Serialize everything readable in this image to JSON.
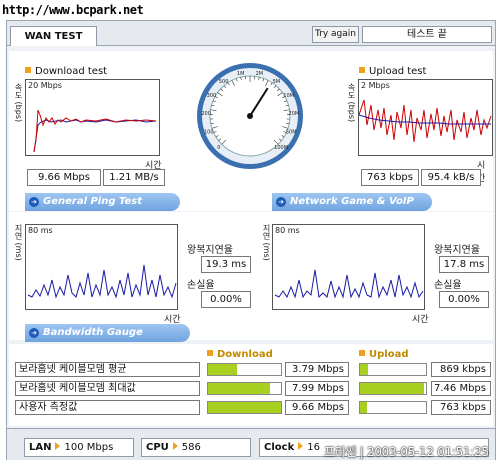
{
  "watermark_top": "http://www.bcpark.net",
  "tab": "WAN TEST",
  "try_again": "Try again",
  "status": "테스트 끝",
  "download": {
    "title": "Download test",
    "ylabel": "속도 (bps)",
    "scale": "20 Mbps",
    "time": "시간",
    "value1": "9.66 Mbps",
    "value2": "1.21 MB/s"
  },
  "upload": {
    "title": "Upload test",
    "ylabel": "속도 (bps)",
    "scale": "2 Mbps",
    "time": "시간",
    "value1": "763 kbps",
    "value2": "95.4 kB/s"
  },
  "gauge": {
    "labels": [
      "0",
      "100",
      "200",
      "300",
      "500",
      "1M",
      "2M",
      "5M",
      "10M",
      "20M",
      "50M",
      "100M"
    ],
    "value_fraction": 0.62
  },
  "ping_button": "General Ping Test",
  "voip_button": "Network Game & VoIP Test",
  "ping": {
    "ylabel": "지연 (ms)",
    "scale": "80 ms",
    "time": "시간",
    "rtt_label": "왕복지연율",
    "rtt": "19.3 ms",
    "loss_label": "손실율",
    "loss": "0.00%"
  },
  "voip": {
    "ylabel": "지연 (ms)",
    "scale": "80 ms",
    "time": "시간",
    "rtt_label": "왕복지연율",
    "rtt": "17.8 ms",
    "loss_label": "손실율",
    "loss": "0.00%"
  },
  "bandwidth_button": "Bandwidth Gauge",
  "bw_download_label": "Download",
  "bw_upload_label": "Upload",
  "bw_rows": [
    {
      "label": "보라홈넷 케이블모뎀 평균",
      "down": "3.79 Mbps",
      "down_fill": 0.4,
      "up": "869 kbps",
      "up_fill": 0.12
    },
    {
      "label": "보라홈넷 케이블모뎀 최대값",
      "down": "7.99 Mbps",
      "down_fill": 0.85,
      "up": "7.46 Mbps",
      "up_fill": 0.97
    },
    {
      "label": "사용자 측정값",
      "down": "9.66 Mbps",
      "down_fill": 1.0,
      "up": "763 kbps",
      "up_fill": 0.1
    }
  ],
  "bottom": {
    "lan_label": "LAN",
    "lan": "100 Mbps",
    "cpu_label": "CPU",
    "cpu": "586",
    "clock_label": "Clock",
    "clock": "16"
  },
  "watermark_bottom": "프라쎈 | 2003-05-12 01:51:25"
}
